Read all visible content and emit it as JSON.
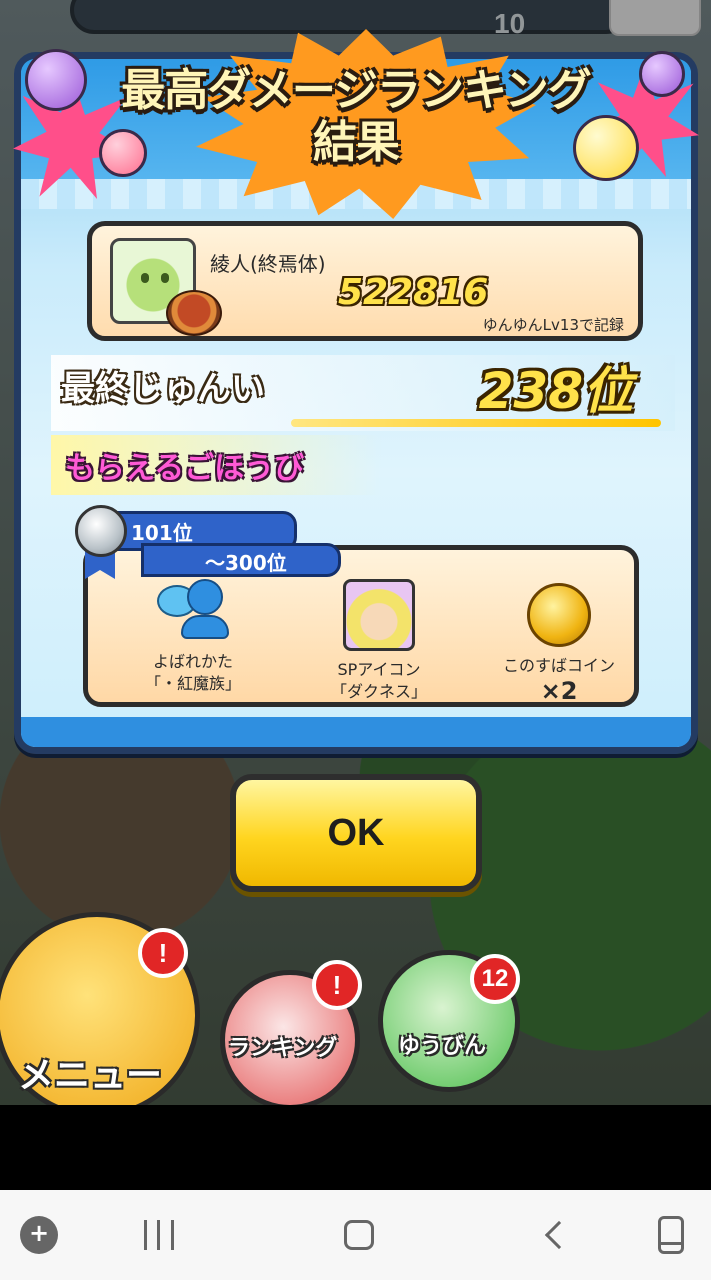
{
  "dialog": {
    "title_line1": "最高ダメージランキング",
    "title_line2": "結果"
  },
  "record": {
    "name": "綾人(終焉体)",
    "score": "522816",
    "note": "ゆんゆんLv13で記録"
  },
  "final_rank": {
    "label": "最終じゅんい",
    "value": "238位"
  },
  "rewards": {
    "heading": "もらえるごほうび",
    "tier_from": "101位",
    "tier_to": "～300位",
    "items": [
      {
        "icon": "chat-person-icon",
        "label_line1": "よばれかた",
        "label_line2": "「・紅魔族」",
        "qty": ""
      },
      {
        "icon": "character-portrait-icon",
        "label_line1": "SPアイコン",
        "label_line2": "「ダクネス」",
        "qty": ""
      },
      {
        "icon": "coin-icon",
        "label_line1": "このすばコイン",
        "label_line2": "",
        "qty": "×2"
      }
    ]
  },
  "ok_button": {
    "label": "OK"
  },
  "game_hud": {
    "top_count": "10"
  },
  "game_nav": {
    "menu_label": "メニュー",
    "ranking_label": "ランキング",
    "mail_label": "ゆうびん",
    "menu_badge": "!",
    "ranking_badge": "!",
    "mail_count": "12"
  },
  "colors": {
    "dialog_border": "#243b62",
    "ok_yellow": "#ffd51f",
    "rank_gold": "#ffe24a",
    "reward_pink": "#ff5ad6",
    "ribbon_blue": "#2f63c9",
    "alert_red": "#e12626"
  }
}
